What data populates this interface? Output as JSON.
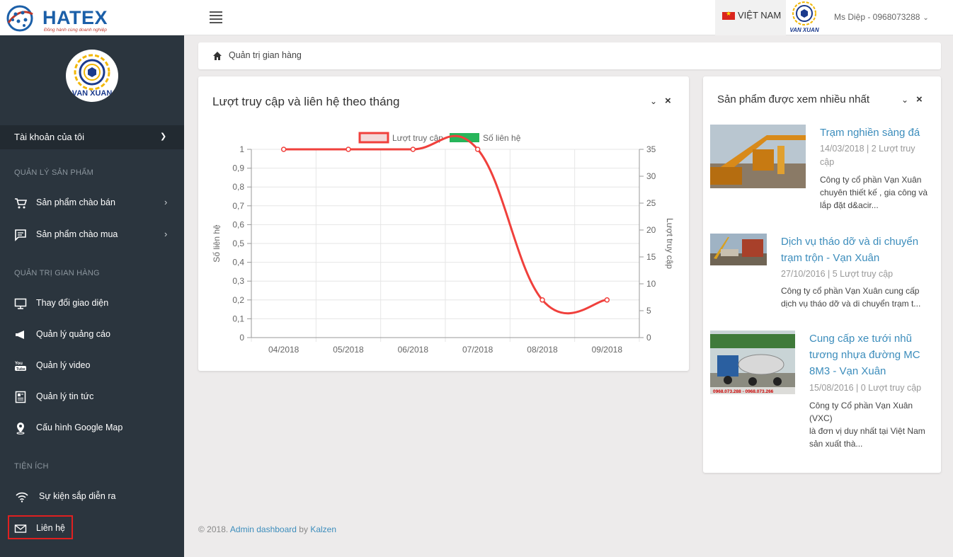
{
  "header": {
    "logo_text": "HATEX",
    "logo_tagline": "Đồng hành cùng doanh nghiệp",
    "language": "VIỆT NAM",
    "company_logo_text": "VAN XUAN",
    "user": "Ms Diệp - 0968073288"
  },
  "sidebar": {
    "avatar_text": "VAN XUAN",
    "account_label": "Tài khoản của tôi",
    "sections": [
      {
        "title": "QUẢN LÝ SẢN PHẨM"
      },
      {
        "title": "QUẢN TRỊ GIAN HÀNG"
      },
      {
        "title": "TIỆN ÍCH"
      }
    ],
    "items": [
      {
        "label": "Sản phẩm chào bán",
        "icon": "cart-icon"
      },
      {
        "label": "Sản phẩm chào mua",
        "icon": "chat-icon"
      },
      {
        "label": "Thay đổi giao diện",
        "icon": "monitor-icon"
      },
      {
        "label": "Quản lý quảng cáo",
        "icon": "megaphone-icon"
      },
      {
        "label": "Quản lý video",
        "icon": "youtube-icon"
      },
      {
        "label": "Quản lý tin tức",
        "icon": "news-icon"
      },
      {
        "label": "Cấu hình Google Map",
        "icon": "map-pin-icon"
      },
      {
        "label": "Sự kiện sắp diễn ra",
        "icon": "wifi-icon"
      },
      {
        "label": "Liên hệ",
        "icon": "mail-icon"
      }
    ]
  },
  "breadcrumb": {
    "label": "Quản trị gian hàng"
  },
  "chart_panel": {
    "title": "Lượt truy cập và liên hệ theo tháng"
  },
  "chart_data": {
    "type": "line",
    "categories": [
      "04/2018",
      "05/2018",
      "06/2018",
      "07/2018",
      "08/2018",
      "09/2018"
    ],
    "series": [
      {
        "name": "Lượt truy cập",
        "color": "#f0403c",
        "axis": "left",
        "values": [
          1,
          1,
          1,
          1,
          0.2,
          0.2
        ]
      },
      {
        "name": "Số liên hệ",
        "color": "#27b55a",
        "axis": "right",
        "values": []
      }
    ],
    "ylabel_left": "Số liên hệ",
    "ylabel_right": "Lượt truy cập",
    "yticks_left": [
      "0",
      "0,1",
      "0,2",
      "0,3",
      "0,4",
      "0,5",
      "0,6",
      "0,7",
      "0,8",
      "0,9",
      "1"
    ],
    "yticks_right": [
      "0",
      "5",
      "10",
      "15",
      "20",
      "25",
      "30",
      "35"
    ],
    "ylim_left": [
      0,
      1
    ],
    "ylim_right": [
      0,
      35
    ],
    "grid": true,
    "legend": "top-center"
  },
  "products_panel": {
    "title": "Sản phẩm được xem nhiều nhất",
    "items": [
      {
        "name_lines": [
          "Trạm nghiền sàng đá"
        ],
        "meta_lines": [
          "14/03/2018 | 2 Lượt truy",
          "cập"
        ],
        "desc_lines": [
          "Công ty cổ phần Vạn Xuân",
          "chuyên thiết kế , gia công và",
          "lắp đặt d&acir..."
        ]
      },
      {
        "name_lines": [
          "Dịch vụ tháo dỡ và di chuyển",
          "trạm trộn - Vạn Xuân"
        ],
        "meta_lines": [
          "27/10/2016 | 5 Lượt truy cập"
        ],
        "desc_lines": [
          "Công ty cổ phần Vạn Xuân cung cấp",
          "dịch vụ tháo dỡ và di chuyển trạm t..."
        ]
      },
      {
        "name_lines": [
          "Cung cấp xe tưới nhũ",
          "tương nhựa đường MC",
          "8M3 - Vạn Xuân"
        ],
        "meta_lines": [
          "15/08/2016 | 0 Lượt truy cập"
        ],
        "desc_lines": [
          "Công ty Cổ phần Vạn Xuân (VXC)",
          "là đơn vị duy nhất tại Việt Nam",
          "sản xuất thà..."
        ],
        "thumb_caption": "0968.073.288 - 0968.073.266"
      }
    ]
  },
  "footer": {
    "prefix": "© 2018.",
    "link1": "Admin dashboard",
    "by": "by",
    "link2": "Kalzen"
  }
}
